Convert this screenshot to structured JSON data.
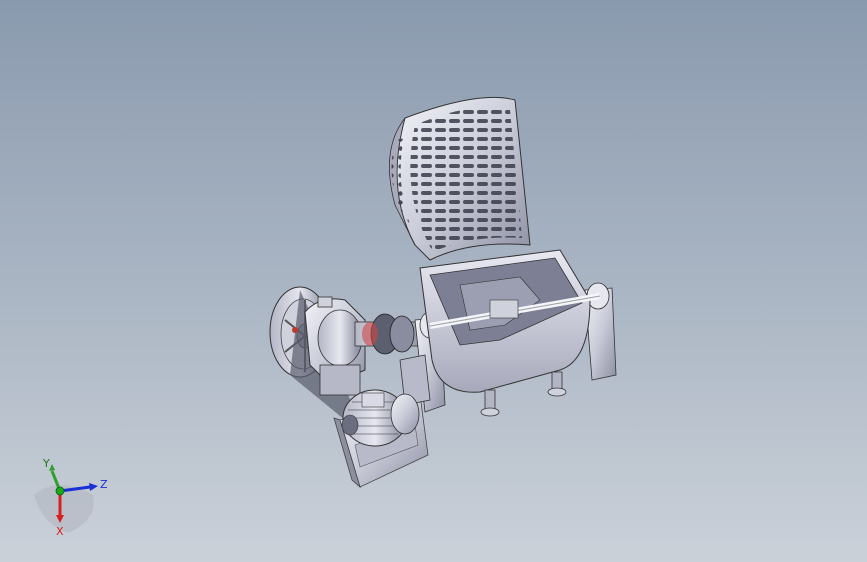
{
  "viewport": {
    "background_top": "#8a9aae",
    "background_bottom": "#cbd1d9"
  },
  "model": {
    "parts": [
      "belt-pulley",
      "gearbox",
      "shaft-coupling",
      "mixer-trough",
      "perforated-hinged-lid",
      "agitator-shaft",
      "bearing-supports",
      "electric-motor",
      "motor-base"
    ]
  },
  "triad": {
    "y_label": "Y",
    "z_label": "Z",
    "x_label": "X",
    "y_color": "#2e9e2e",
    "z_color": "#1b2fd6",
    "x_color": "#d62020"
  }
}
